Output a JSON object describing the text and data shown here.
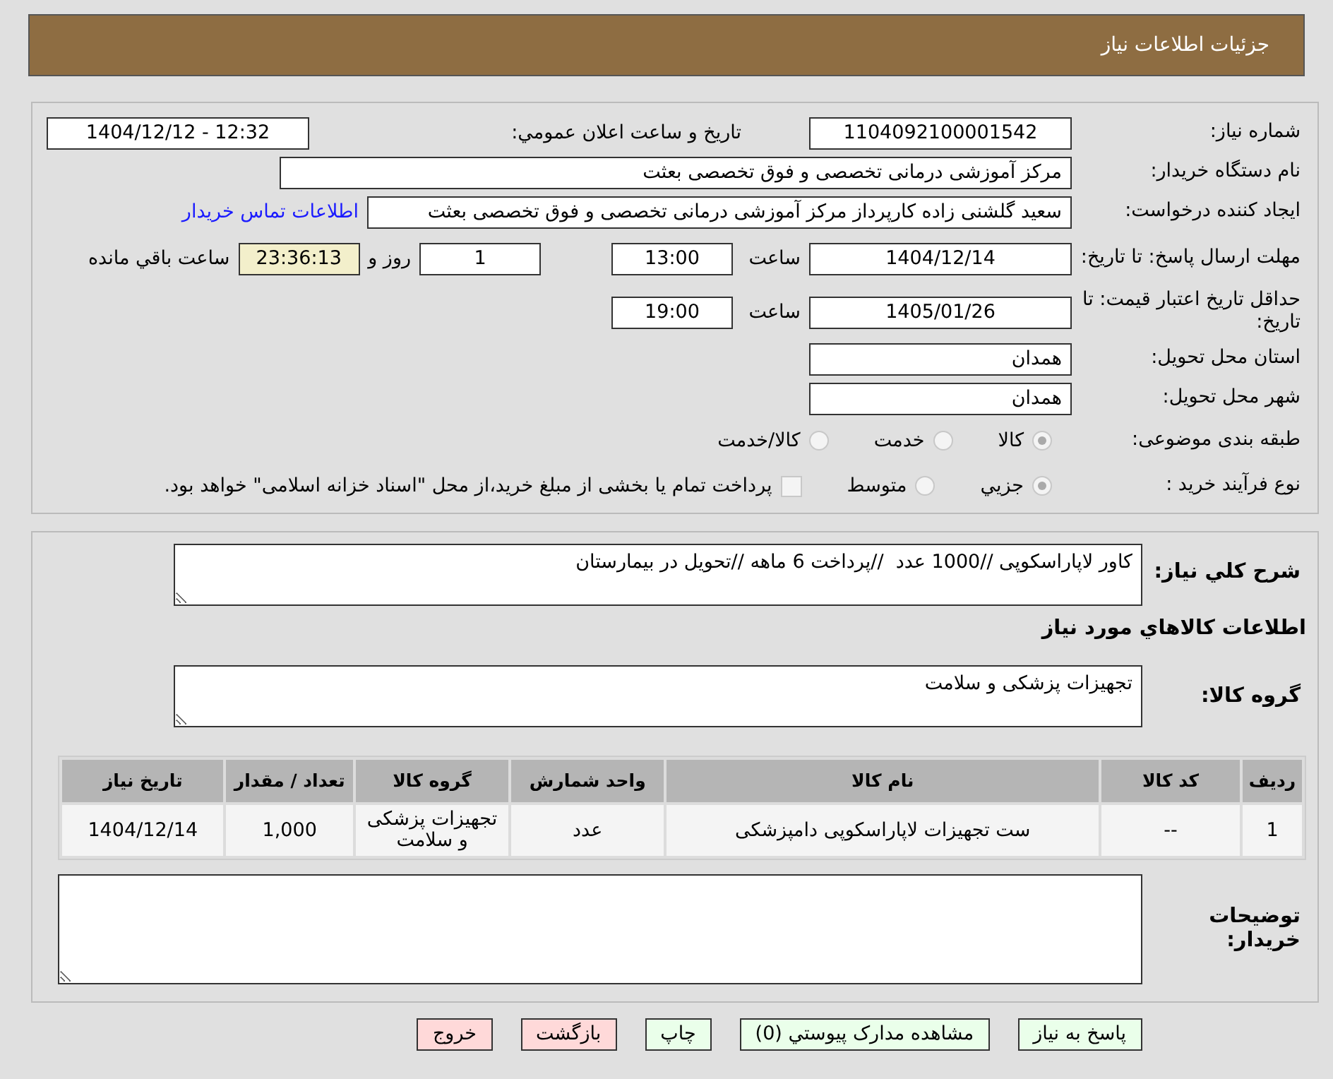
{
  "header": {
    "title": "جزئیات اطلاعات نیاز"
  },
  "fields": {
    "need_number": {
      "label": "شماره نیاز:",
      "value": "1104092100001542"
    },
    "announce": {
      "label": "تاریخ و ساعت اعلان عمومي:",
      "value": "1404/12/12 - 12:32"
    },
    "buyer_org": {
      "label": "نام دستگاه خریدار:",
      "value": "مرکز آموزشی درمانی تخصصی و فوق تخصصی بعثت"
    },
    "requester": {
      "label": "ایجاد کننده درخواست:",
      "value": "سعید گلشنی زاده کارپرداز مرکز آموزشی درمانی تخصصی و فوق تخصصی بعثت",
      "link": "اطلاعات تماس خریدار"
    },
    "deadline": {
      "label": "مهلت ارسال پاسخ: تا تاریخ:",
      "date": "1404/12/14",
      "time_label": "ساعت",
      "time": "13:00",
      "days": "1",
      "days_label": "روز و",
      "remaining": "23:36:13",
      "remaining_label": "ساعت باقي مانده"
    },
    "validity": {
      "label": "حداقل تاریخ اعتبار قیمت: تا تاریخ:",
      "date": "1405/01/26",
      "time_label": "ساعت",
      "time": "19:00"
    },
    "province": {
      "label": "استان محل تحویل:",
      "value": "همدان"
    },
    "city": {
      "label": "شهر محل تحویل:",
      "value": "همدان"
    },
    "category": {
      "label": "طبقه بندی موضوعی:",
      "options": [
        {
          "label": "کالا",
          "selected": true
        },
        {
          "label": "خدمت",
          "selected": false
        },
        {
          "label": "کالا/خدمت",
          "selected": false
        }
      ]
    },
    "process": {
      "label": "نوع فرآیند خرید :",
      "options": [
        {
          "label": "جزيي",
          "selected": true
        },
        {
          "label": "متوسط",
          "selected": false
        }
      ],
      "treasury": {
        "checked": false,
        "note": "پرداخت تمام یا بخشی از مبلغ خرید،از محل \"اسناد خزانه اسلامی\" خواهد بود."
      }
    }
  },
  "details": {
    "description_label": "شرح کلي نیاز:",
    "description": "کاور لاپاراسکوپی //1000 عدد  //پرداخت 6 ماهه //تحویل در بیمارستان",
    "goods_title": "اطلاعات کالاهاي مورد نیاز",
    "group_label": "گروه کالا:",
    "group": "تجهیزات پزشکی و سلامت",
    "table": {
      "columns": [
        "ردیف",
        "کد کالا",
        "نام کالا",
        "واحد شمارش",
        "گروه کالا",
        "تعداد / مقدار",
        "تاریخ نیاز"
      ],
      "rows": [
        [
          "1",
          "--",
          "ست تجهیزات لاپاراسکوپی دامپزشکی",
          "عدد",
          "تجهیزات پزشکی و سلامت",
          "1,000",
          "1404/12/14"
        ]
      ]
    },
    "notes_label": "توضیحات خریدار:"
  },
  "buttons": [
    {
      "label": "پاسخ به نیاز",
      "kind": "accept"
    },
    {
      "label": "مشاهده مدارک پیوستي (0)",
      "kind": "accept"
    },
    {
      "label": "چاپ",
      "kind": "accept"
    },
    {
      "label": "بازگشت",
      "kind": "danger"
    },
    {
      "label": "خروج",
      "kind": "danger"
    }
  ]
}
